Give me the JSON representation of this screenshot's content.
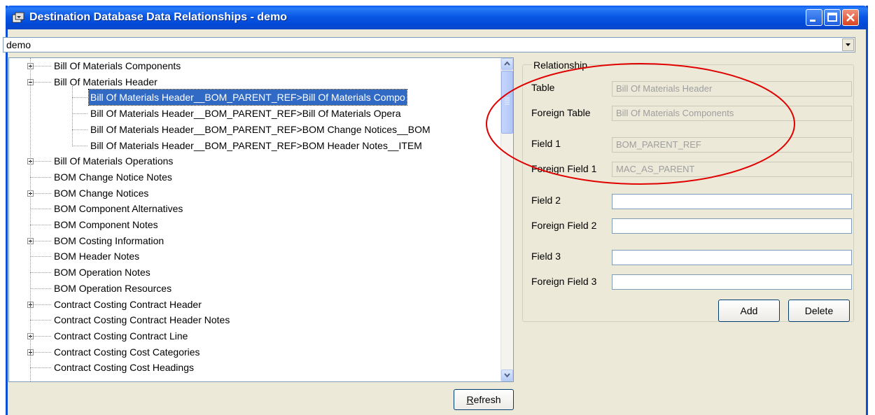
{
  "window": {
    "title": "Destination Database Data Relationships - demo"
  },
  "database_select": {
    "value": "demo"
  },
  "tree": {
    "items": [
      {
        "label": "Bill Of Materials Components",
        "expander": "plus"
      },
      {
        "label": "Bill Of Materials Header",
        "expander": "minus"
      },
      {
        "label": "Bill Of Materials Header__BOM_PARENT_REF>Bill Of Materials Compo",
        "child": true,
        "selected": true
      },
      {
        "label": "Bill Of Materials Header__BOM_PARENT_REF>Bill Of Materials Opera",
        "child": true
      },
      {
        "label": "Bill Of Materials Header__BOM_PARENT_REF>BOM Change Notices__BOM",
        "child": true
      },
      {
        "label": "Bill Of Materials Header__BOM_PARENT_REF>BOM Header Notes__ITEM",
        "child": true
      },
      {
        "label": "Bill Of Materials Operations",
        "expander": "plus"
      },
      {
        "label": "BOM Change Notice Notes"
      },
      {
        "label": "BOM Change Notices",
        "expander": "plus"
      },
      {
        "label": "BOM Component Alternatives"
      },
      {
        "label": "BOM Component Notes"
      },
      {
        "label": "BOM Costing Information",
        "expander": "plus"
      },
      {
        "label": "BOM Header Notes"
      },
      {
        "label": "BOM Operation Notes"
      },
      {
        "label": "BOM Operation Resources"
      },
      {
        "label": "Contract Costing Contract Header",
        "expander": "plus"
      },
      {
        "label": "Contract Costing Contract Header Notes"
      },
      {
        "label": "Contract Costing Contract Line",
        "expander": "plus"
      },
      {
        "label": "Contract Costing Cost Categories",
        "expander": "plus"
      },
      {
        "label": "Contract Costing Cost Headings"
      }
    ]
  },
  "buttons": {
    "refresh_pre": "",
    "refresh_accel": "R",
    "refresh_post": "efresh",
    "add": "Add",
    "delete": "Delete"
  },
  "relationship": {
    "group_title": "Relationship",
    "fields": [
      {
        "label": "Table",
        "value": "Bill Of Materials Header",
        "disabled": true
      },
      {
        "label": "Foreign Table",
        "value": "Bill Of Materials Components",
        "disabled": true
      },
      {
        "label": "Field 1",
        "value": "BOM_PARENT_REF",
        "disabled": true
      },
      {
        "label": "Foreign Field 1",
        "value": "MAC_AS_PARENT",
        "disabled": true
      },
      {
        "label": "Field 2",
        "value": ""
      },
      {
        "label": "Foreign Field 2",
        "value": ""
      },
      {
        "label": "Field 3",
        "value": ""
      },
      {
        "label": "Foreign Field 3",
        "value": ""
      }
    ]
  },
  "colors": {
    "titlebar": "#0a58e6",
    "selection": "#316ac5",
    "annotation": "#e00000",
    "window_bg": "#ece9d8"
  },
  "icons": [
    "app-icon",
    "minimize-icon",
    "maximize-icon",
    "close-icon",
    "dropdown-arrow-icon",
    "scroll-up-icon",
    "scroll-down-icon"
  ]
}
